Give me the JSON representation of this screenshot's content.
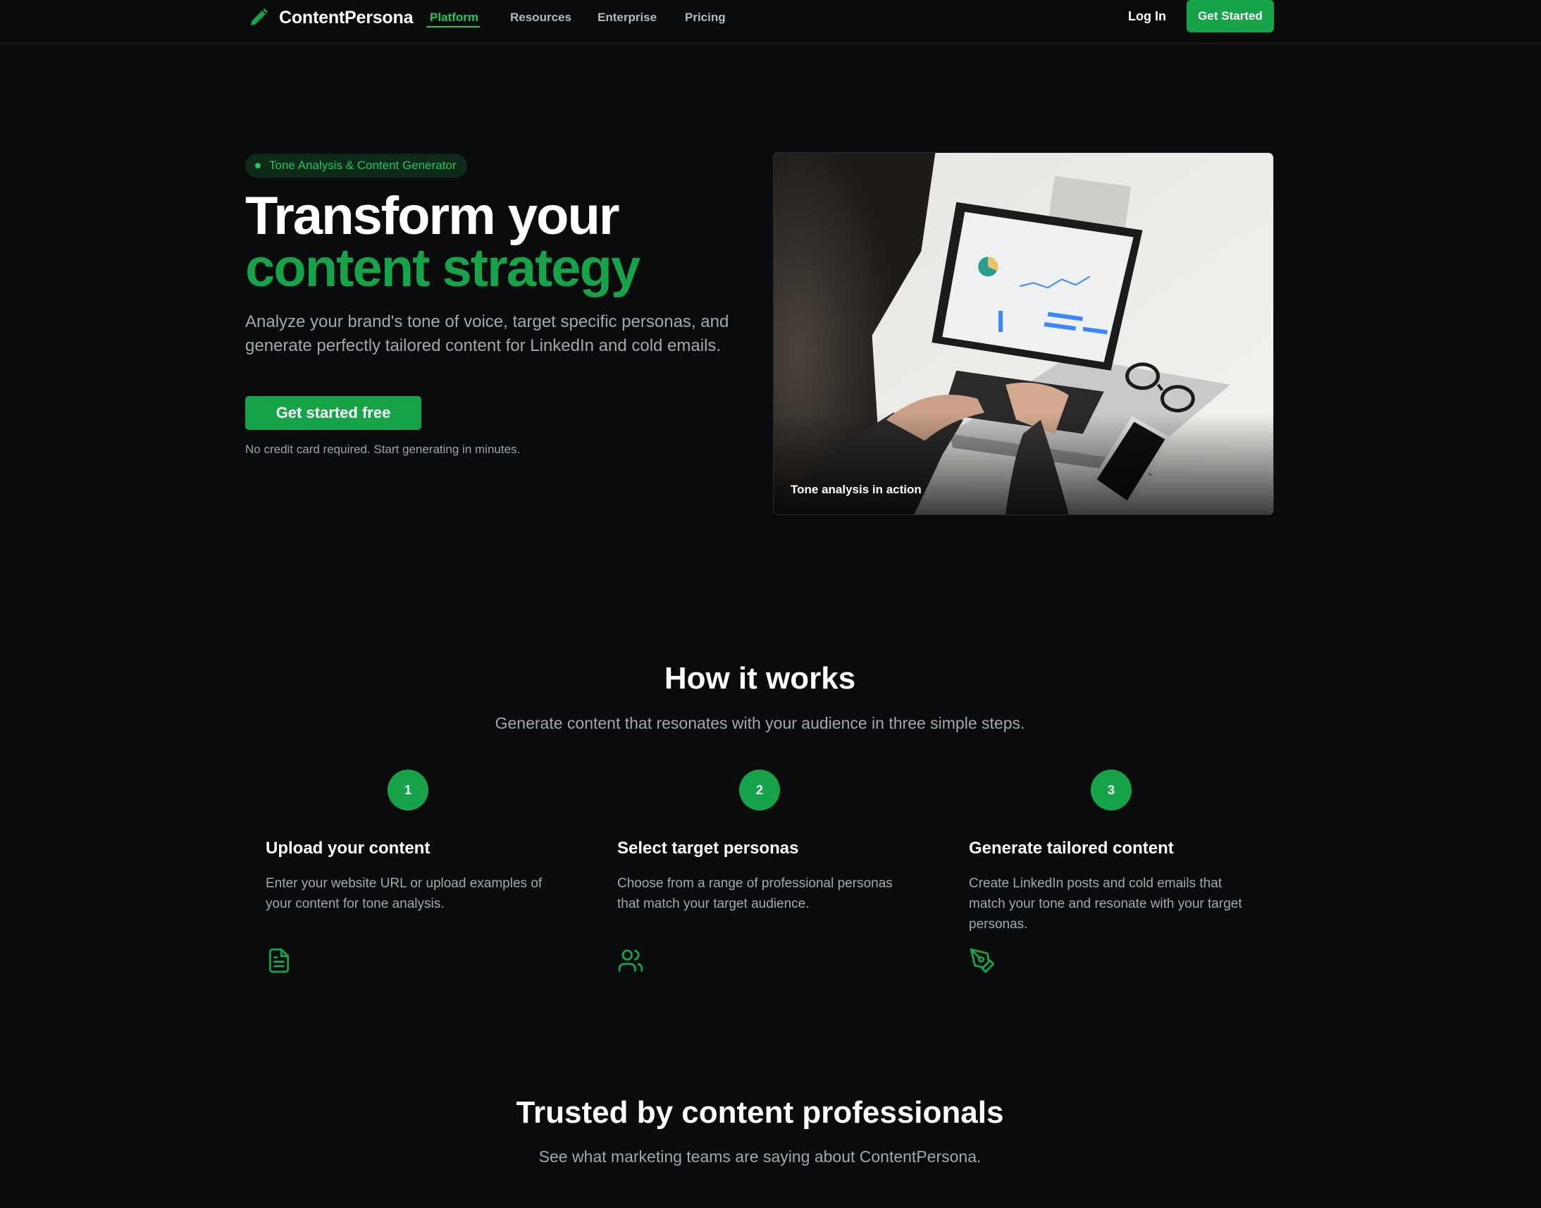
{
  "nav": {
    "brand": "ContentPersona",
    "links": [
      "Platform",
      "Resources",
      "Enterprise",
      "Pricing"
    ],
    "login": "Log In",
    "cta": "Get Started"
  },
  "hero": {
    "badge": "Tone Analysis & Content Generator",
    "title_line1": "Transform your",
    "title_line2": "content strategy",
    "subtitle": "Analyze your brand's tone of voice, target specific personas, and generate perfectly tailored content for LinkedIn and cold emails.",
    "cta": "Get started free",
    "note": "No credit card required. Start generating in minutes.",
    "image_caption": "Tone analysis in action"
  },
  "how": {
    "title": "How it works",
    "subtitle": "Generate content that resonates with your audience in three simple steps.",
    "steps": [
      {
        "num": "1",
        "title": "Upload your content",
        "desc": "Enter your website URL or upload examples of your content for tone analysis.",
        "icon": "document-icon"
      },
      {
        "num": "2",
        "title": "Select target personas",
        "desc": "Choose from a range of professional personas that match your target audience.",
        "icon": "users-icon"
      },
      {
        "num": "3",
        "title": "Generate tailored content",
        "desc": "Create LinkedIn posts and cold emails that match your tone and resonate with your target personas.",
        "icon": "pen-tool-icon"
      }
    ]
  },
  "trusted": {
    "title": "Trusted by content professionals",
    "subtitle": "See what marketing teams are saying about ContentPersona."
  },
  "colors": {
    "accent": "#16a34a",
    "accent_text": "#22c55e",
    "background": "#0a0b0d"
  }
}
